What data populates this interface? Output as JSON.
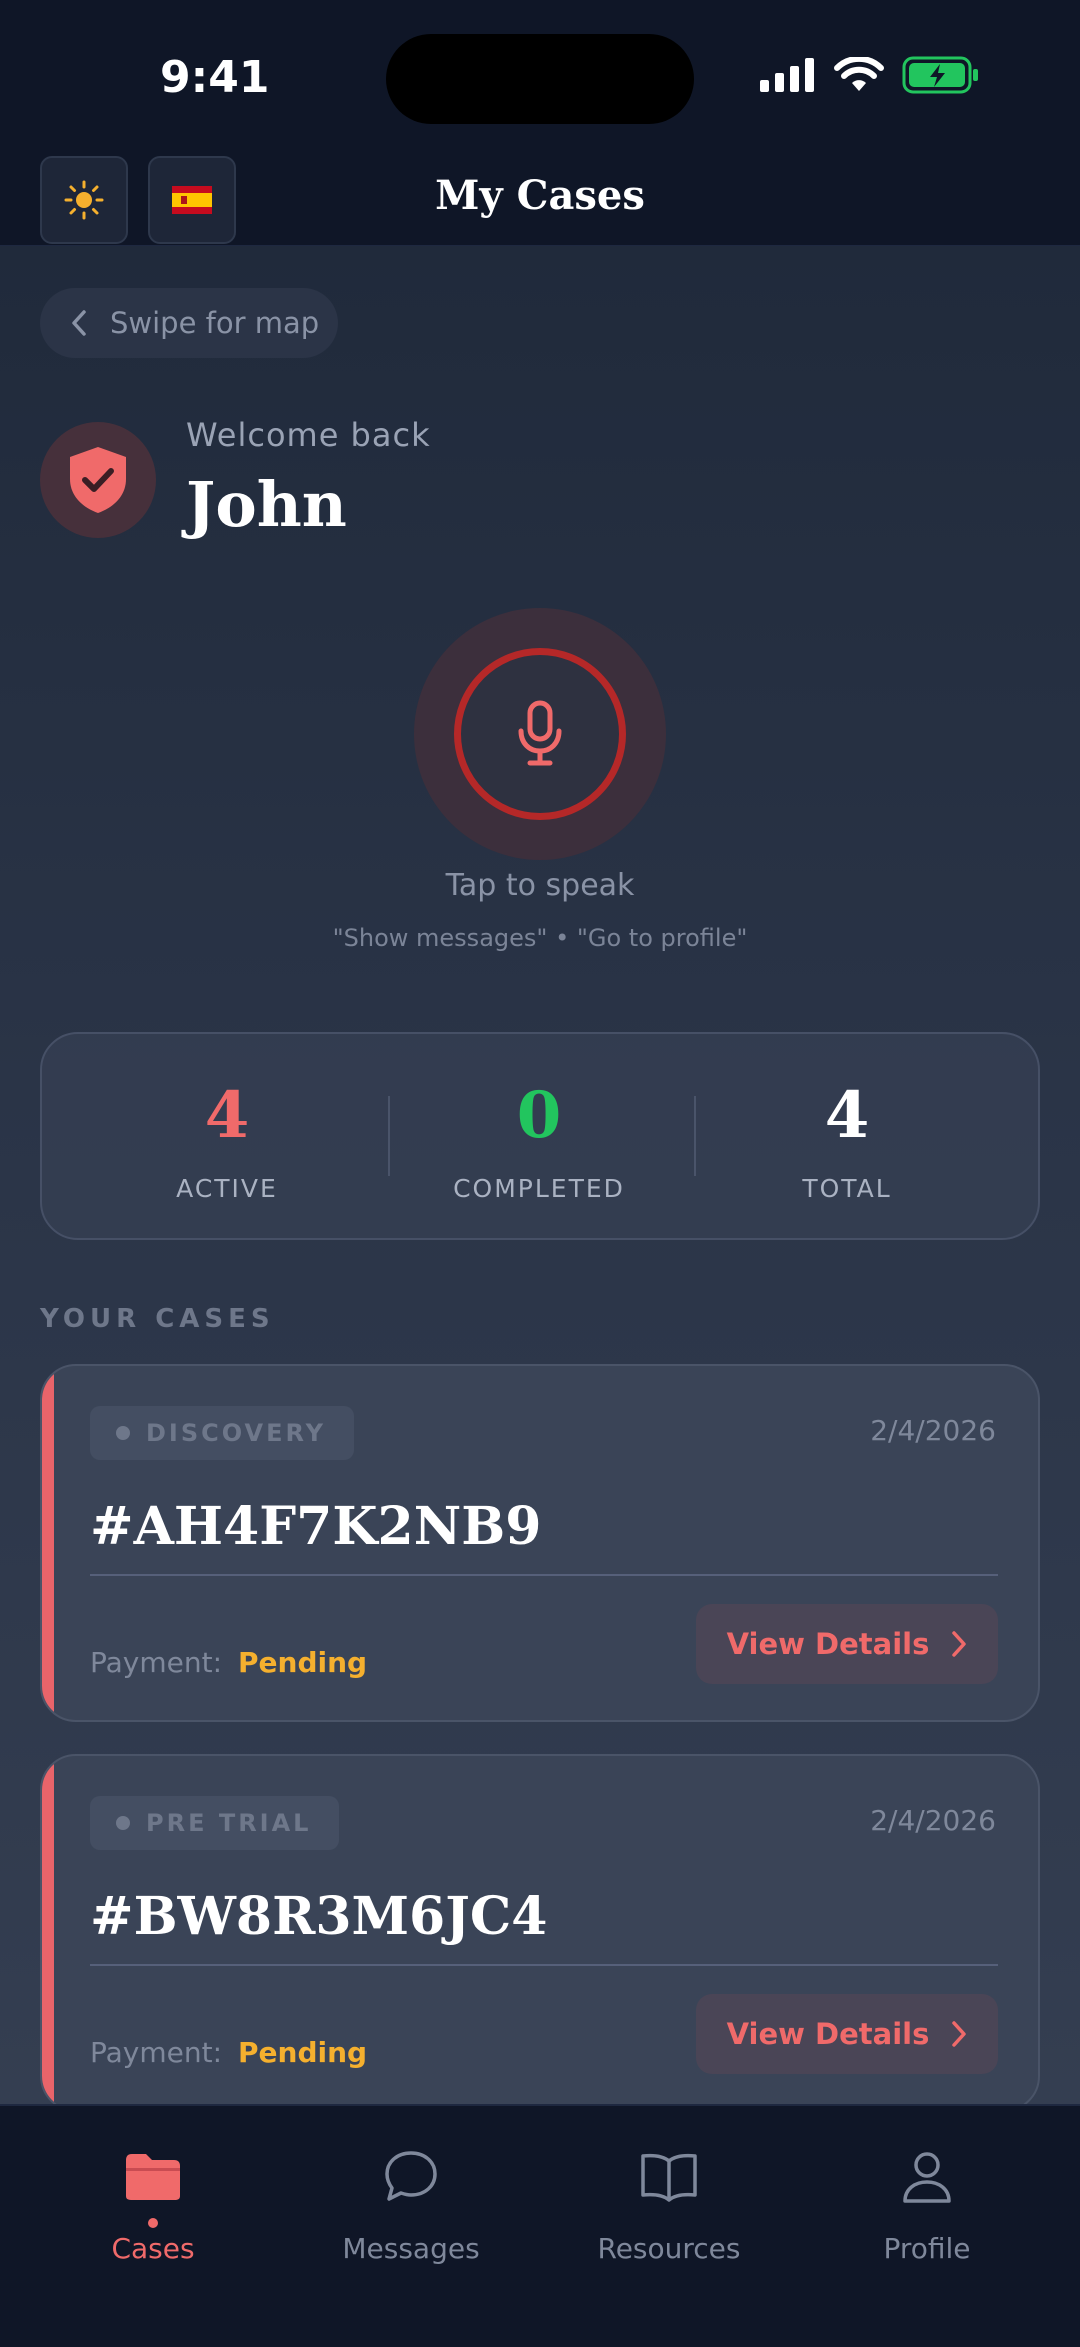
{
  "status_bar": {
    "time": "9:41"
  },
  "header": {
    "title": "My Cases",
    "flag": "🇪🇸"
  },
  "swipe": {
    "label": "Swipe for map"
  },
  "welcome": {
    "greeting": "Welcome back",
    "name": "John"
  },
  "voice": {
    "prompt": "Tap to speak",
    "hint": "\"Show messages\" • \"Go to profile\""
  },
  "stats": [
    {
      "value": "4",
      "label": "ACTIVE",
      "color": "#f06a6a"
    },
    {
      "value": "0",
      "label": "COMPLETED",
      "color": "#22c55e"
    },
    {
      "value": "4",
      "label": "TOTAL",
      "color": "#ffffff"
    }
  ],
  "cases_section": {
    "title": "YOUR CASES"
  },
  "cases": [
    {
      "status": "DISCOVERY",
      "date": "2/4/2026",
      "id": "#AH4F7K2NB9",
      "payment_label": "Payment:",
      "payment_value": "Pending",
      "button": "View Details"
    },
    {
      "status": "PRE TRIAL",
      "date": "2/4/2026",
      "id": "#BW8R3M6JC4",
      "payment_label": "Payment:",
      "payment_value": "Pending",
      "button": "View Details"
    }
  ],
  "nav": [
    {
      "label": "Cases",
      "icon": "folder-icon",
      "active": true
    },
    {
      "label": "Messages",
      "icon": "chat-bubble-icon",
      "active": false
    },
    {
      "label": "Resources",
      "icon": "book-icon",
      "active": false
    },
    {
      "label": "Profile",
      "icon": "user-icon",
      "active": false
    }
  ],
  "colors": {
    "accent": "#f06a6a",
    "pending": "#f5b02e",
    "completed": "#22c55e",
    "background": "#0f1627"
  }
}
